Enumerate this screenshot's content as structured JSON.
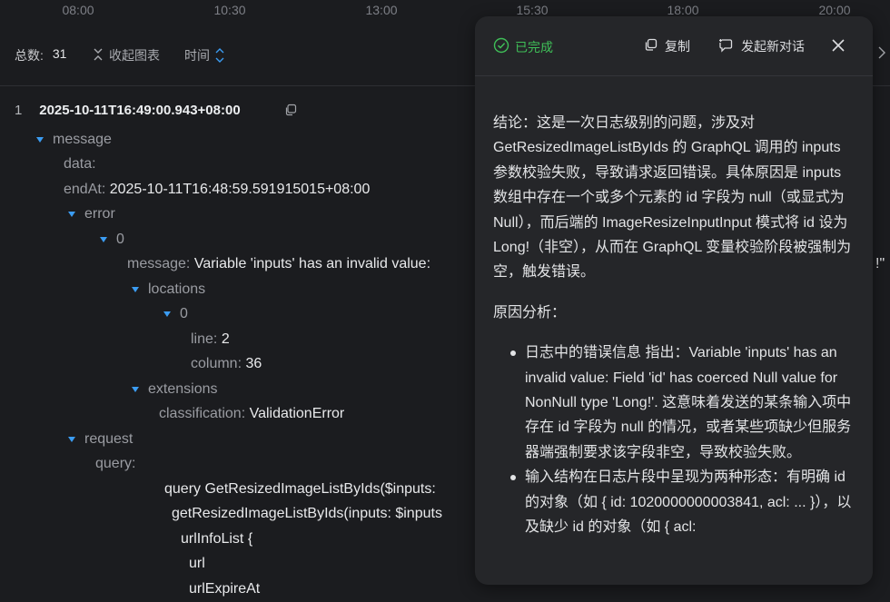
{
  "timeline": {
    "ticks": [
      "08:00",
      "10:30",
      "13:00",
      "15:30",
      "18:00",
      "20:00"
    ]
  },
  "toolbar": {
    "total_label": "总数:",
    "total_value": "31",
    "collapse_label": "收起图表",
    "sort_label": "时间"
  },
  "log": {
    "index": "1",
    "timestamp": "2025-10-11T16:49:00.943+08:00",
    "message_key": "message",
    "data_key": "data:",
    "endAt_key": "endAt:",
    "endAt_value": "2025-10-11T16:48:59.591915015+08:00",
    "error_key": "error",
    "item0_key": "0",
    "msg_key": "message:",
    "msg_value": "Variable 'inputs' has an invalid value:",
    "locations_key": "locations",
    "loc0_key": "0",
    "line_key": "line:",
    "line_value": "2",
    "column_key": "column:",
    "column_value": "36",
    "extensions_key": "extensions",
    "classification_key": "classification:",
    "classification_value": "ValidationError",
    "request_key": "request",
    "query_key": "query:",
    "query_lines": [
      "query GetResizedImageListByIds($inputs:",
      "getResizedImageListByIds(inputs: $inputs",
      "urlInfoList {",
      "url",
      "urlExpireAt"
    ],
    "overflow_right": "!\""
  },
  "panel": {
    "status": "已完成",
    "copy_label": "复制",
    "new_chat_label": "发起新对话",
    "conclusion": "结论：这是一次日志级别的问题，涉及对 GetResizedImageListByIds 的 GraphQL 调用的 inputs 参数校验失败，导致请求返回错误。具体原因是 inputs 数组中存在一个或多个元素的 id 字段为 null（或显式为 Null），而后端的 ImageResizeInputInput 模式将 id 设为 Long!（非空），从而在 GraphQL 变量校验阶段被强制为空，触发错误。",
    "analysis_title": "原因分析：",
    "bullets": [
      "日志中的错误信息 指出：Variable 'inputs' has an invalid value: Field 'id' has coerced Null value for NonNull type 'Long!'. 这意味着发送的某条输入项中存在 id 字段为 null 的情况，或者某些项缺少但服务器端强制要求该字段非空，导致校验失败。",
      "输入结构在日志片段中呈现为两种形态：有明确 id 的对象（如 { id: 1020000000003841, acl: ... }），以及缺少 id 的对象（如 { acl:"
    ]
  },
  "colors": {
    "background": "#1b1c1f",
    "panel": "#252629",
    "accent_blue": "#3b9cf2",
    "status_green": "#3fbf58"
  }
}
